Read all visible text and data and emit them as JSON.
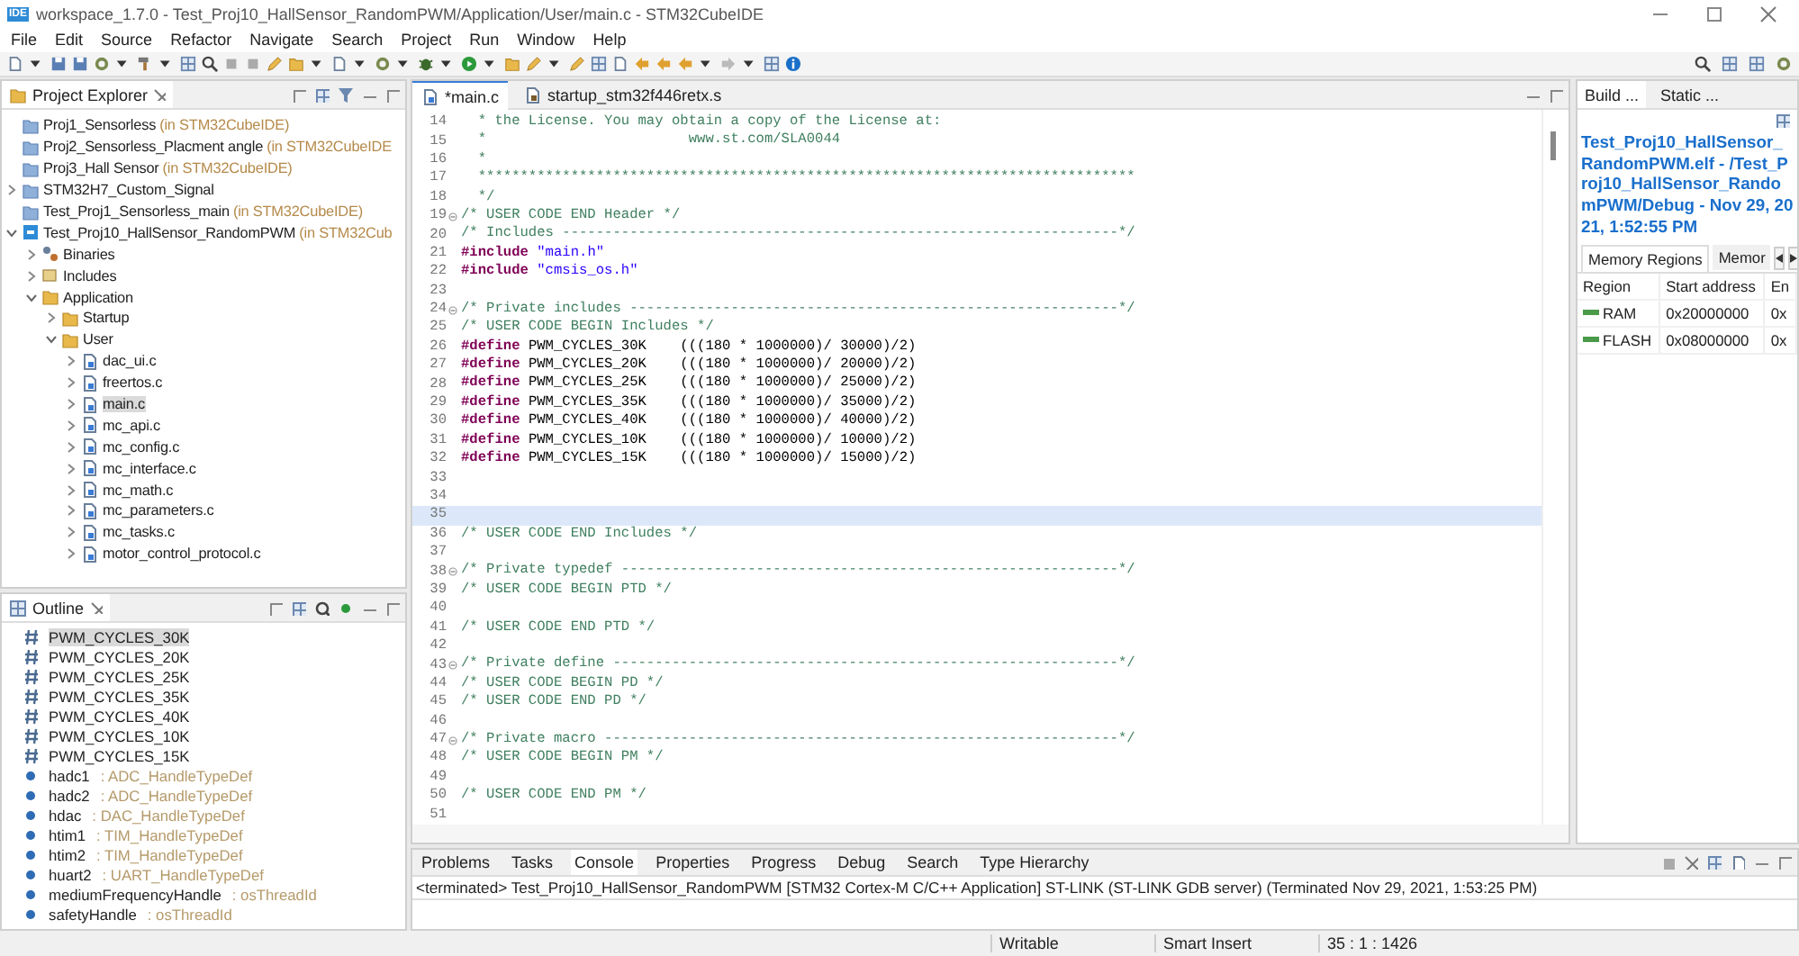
{
  "window": {
    "logo": "IDE",
    "title": "workspace_1.7.0 - Test_Proj10_HallSensor_RandomPWM/Application/User/main.c - STM32CubeIDE"
  },
  "menu": [
    "File",
    "Edit",
    "Source",
    "Refactor",
    "Navigate",
    "Search",
    "Project",
    "Run",
    "Window",
    "Help"
  ],
  "project_explorer": {
    "title": "Project Explorer",
    "items": [
      {
        "kind": "closed-project",
        "name": "Proj1_Sensorless",
        "location": "(in STM32CubeIDE)",
        "selected": false
      },
      {
        "kind": "closed-project",
        "name": "Proj2_Sensorless_Placment angle",
        "location": "(in STM32CubeIDE",
        "selected": false
      },
      {
        "kind": "closed-project",
        "name": "Proj3_Hall Sensor",
        "location": "(in STM32CubeIDE)",
        "selected": false
      },
      {
        "kind": "project",
        "name": "STM32H7_Custom_Signal",
        "expanded": false,
        "selected": false
      },
      {
        "kind": "closed-project",
        "name": "Test_Proj1_Sensorless_main",
        "location": "(in STM32CubeIDE)",
        "selected": false
      },
      {
        "kind": "ide-project",
        "name": "Test_Proj10_HallSensor_RandomPWM",
        "location": "(in STM32Cub",
        "expanded": true,
        "selected": false,
        "children": [
          {
            "kind": "binaries",
            "name": "Binaries",
            "expanded": false,
            "selected": false
          },
          {
            "kind": "includes",
            "name": "Includes",
            "expanded": false,
            "selected": false
          },
          {
            "kind": "folder",
            "name": "Application",
            "expanded": true,
            "selected": false,
            "children": [
              {
                "kind": "folder",
                "name": "Startup",
                "expanded": false,
                "selected": false
              },
              {
                "kind": "folder",
                "name": "User",
                "expanded": true,
                "selected": false,
                "children": [
                  {
                    "kind": "file",
                    "name": "dac_ui.c",
                    "expanded": false,
                    "selected": false
                  },
                  {
                    "kind": "file",
                    "name": "freertos.c",
                    "expanded": false,
                    "selected": false
                  },
                  {
                    "kind": "file",
                    "name": "main.c",
                    "expanded": false,
                    "selected": true
                  },
                  {
                    "kind": "file",
                    "name": "mc_api.c",
                    "expanded": false,
                    "selected": false
                  },
                  {
                    "kind": "file",
                    "name": "mc_config.c",
                    "expanded": false,
                    "selected": false
                  },
                  {
                    "kind": "file",
                    "name": "mc_interface.c",
                    "expanded": false,
                    "selected": false
                  },
                  {
                    "kind": "file",
                    "name": "mc_math.c",
                    "expanded": false,
                    "selected": false
                  },
                  {
                    "kind": "file",
                    "name": "mc_parameters.c",
                    "expanded": false,
                    "selected": false
                  },
                  {
                    "kind": "file",
                    "name": "mc_tasks.c",
                    "expanded": false,
                    "selected": false
                  },
                  {
                    "kind": "file",
                    "name": "motor_control_protocol.c",
                    "expanded": false,
                    "selected": false
                  }
                ]
              }
            ]
          }
        ]
      }
    ]
  },
  "outline": {
    "title": "Outline",
    "items": [
      {
        "kind": "macro",
        "name": "PWM_CYCLES_30K",
        "selected": true
      },
      {
        "kind": "macro",
        "name": "PWM_CYCLES_20K",
        "selected": false
      },
      {
        "kind": "macro",
        "name": "PWM_CYCLES_25K",
        "selected": false
      },
      {
        "kind": "macro",
        "name": "PWM_CYCLES_35K",
        "selected": false
      },
      {
        "kind": "macro",
        "name": "PWM_CYCLES_40K",
        "selected": false
      },
      {
        "kind": "macro",
        "name": "PWM_CYCLES_10K",
        "selected": false
      },
      {
        "kind": "macro",
        "name": "PWM_CYCLES_15K",
        "selected": false
      },
      {
        "kind": "variable",
        "name": "hadc1",
        "type": ": ADC_HandleTypeDef",
        "selected": false
      },
      {
        "kind": "variable",
        "name": "hadc2",
        "type": ": ADC_HandleTypeDef",
        "selected": false
      },
      {
        "kind": "variable",
        "name": "hdac",
        "type": ": DAC_HandleTypeDef",
        "selected": false
      },
      {
        "kind": "variable",
        "name": "htim1",
        "type": ": TIM_HandleTypeDef",
        "selected": false
      },
      {
        "kind": "variable",
        "name": "htim2",
        "type": ": TIM_HandleTypeDef",
        "selected": false
      },
      {
        "kind": "variable",
        "name": "huart2",
        "type": ": UART_HandleTypeDef",
        "selected": false
      },
      {
        "kind": "variable",
        "name": "mediumFrequencyHandle",
        "type": ": osThreadId",
        "selected": false
      },
      {
        "kind": "variable",
        "name": "safetyHandle",
        "type": ": osThreadId",
        "selected": false
      }
    ]
  },
  "editor": {
    "tabs": [
      {
        "label": "*main.c",
        "kind": "c-file",
        "selected": true
      },
      {
        "label": "startup_stm32f446retx.s",
        "kind": "asm-file",
        "selected": false
      }
    ],
    "lines": [
      {
        "number": "14",
        "fold": false,
        "current": false,
        "code": [
          {
            "kind": "comment",
            "text": "  * the License. You may obtain a copy of the License at:"
          }
        ]
      },
      {
        "number": "15",
        "fold": false,
        "current": false,
        "code": [
          {
            "kind": "comment",
            "text": "  *                        www.st.com/SLA0044"
          }
        ]
      },
      {
        "number": "16",
        "fold": false,
        "current": false,
        "code": [
          {
            "kind": "comment",
            "text": "  *"
          }
        ]
      },
      {
        "number": "17",
        "fold": false,
        "current": false,
        "code": [
          {
            "kind": "comment",
            "text": "  ******************************************************************************"
          }
        ]
      },
      {
        "number": "18",
        "fold": false,
        "current": false,
        "code": [
          {
            "kind": "comment",
            "text": "  */"
          }
        ]
      },
      {
        "number": "19",
        "fold": true,
        "current": false,
        "code": [
          {
            "kind": "comment",
            "text": "/* USER CODE END Header */"
          }
        ]
      },
      {
        "number": "20",
        "fold": false,
        "current": false,
        "code": [
          {
            "kind": "comment",
            "text": "/* Includes ------------------------------------------------------------------*/"
          }
        ]
      },
      {
        "number": "21",
        "fold": false,
        "current": false,
        "code": [
          {
            "kind": "keyword",
            "text": "#include "
          },
          {
            "kind": "string",
            "text": "\"main.h\""
          }
        ]
      },
      {
        "number": "22",
        "fold": false,
        "current": false,
        "code": [
          {
            "kind": "keyword",
            "text": "#include "
          },
          {
            "kind": "string",
            "text": "\"cmsis_os.h\""
          }
        ]
      },
      {
        "number": "23",
        "fold": false,
        "current": false
      },
      {
        "number": "24",
        "fold": true,
        "current": false,
        "code": [
          {
            "kind": "comment",
            "text": "/* Private includes ----------------------------------------------------------*/"
          }
        ]
      },
      {
        "number": "25",
        "fold": false,
        "current": false,
        "code": [
          {
            "kind": "comment",
            "text": "/* USER CODE BEGIN Includes */"
          }
        ]
      },
      {
        "number": "26",
        "fold": false,
        "current": false,
        "code": [
          {
            "kind": "keyword",
            "text": "#define"
          },
          {
            "kind": "plain",
            "text": " PWM_CYCLES_30K    (((180 * 1000000)/ 30000)/2)"
          }
        ]
      },
      {
        "number": "27",
        "fold": false,
        "current": false,
        "code": [
          {
            "kind": "keyword",
            "text": "#define"
          },
          {
            "kind": "plain",
            "text": " PWM_CYCLES_20K    (((180 * 1000000)/ 20000)/2)"
          }
        ]
      },
      {
        "number": "28",
        "fold": false,
        "current": false,
        "code": [
          {
            "kind": "keyword",
            "text": "#define"
          },
          {
            "kind": "plain",
            "text": " PWM_CYCLES_25K    (((180 * 1000000)/ 25000)/2)"
          }
        ]
      },
      {
        "number": "29",
        "fold": false,
        "current": false,
        "code": [
          {
            "kind": "keyword",
            "text": "#define"
          },
          {
            "kind": "plain",
            "text": " PWM_CYCLES_35K    (((180 * 1000000)/ 35000)/2)"
          }
        ]
      },
      {
        "number": "30",
        "fold": false,
        "current": false,
        "code": [
          {
            "kind": "keyword",
            "text": "#define"
          },
          {
            "kind": "plain",
            "text": " PWM_CYCLES_40K    (((180 * 1000000)/ 40000)/2)"
          }
        ]
      },
      {
        "number": "31",
        "fold": false,
        "current": false,
        "code": [
          {
            "kind": "keyword",
            "text": "#define"
          },
          {
            "kind": "plain",
            "text": " PWM_CYCLES_10K    (((180 * 1000000)/ 10000)/2)"
          }
        ]
      },
      {
        "number": "32",
        "fold": false,
        "current": false,
        "code": [
          {
            "kind": "keyword",
            "text": "#define"
          },
          {
            "kind": "plain",
            "text": " PWM_CYCLES_15K    (((180 * 1000000)/ 15000)/2)"
          }
        ]
      },
      {
        "number": "33",
        "fold": false,
        "current": false
      },
      {
        "number": "34",
        "fold": false,
        "current": false
      },
      {
        "number": "35",
        "fold": false,
        "current": true
      },
      {
        "number": "36",
        "fold": false,
        "current": false,
        "code": [
          {
            "kind": "comment",
            "text": "/* USER CODE END Includes */"
          }
        ]
      },
      {
        "number": "37",
        "fold": false,
        "current": false
      },
      {
        "number": "38",
        "fold": true,
        "current": false,
        "code": [
          {
            "kind": "comment",
            "text": "/* Private typedef -----------------------------------------------------------*/"
          }
        ]
      },
      {
        "number": "39",
        "fold": false,
        "current": false,
        "code": [
          {
            "kind": "comment",
            "text": "/* USER CODE BEGIN PTD */"
          }
        ]
      },
      {
        "number": "40",
        "fold": false,
        "current": false
      },
      {
        "number": "41",
        "fold": false,
        "current": false,
        "code": [
          {
            "kind": "comment",
            "text": "/* USER CODE END PTD */"
          }
        ]
      },
      {
        "number": "42",
        "fold": false,
        "current": false
      },
      {
        "number": "43",
        "fold": true,
        "current": false,
        "code": [
          {
            "kind": "comment",
            "text": "/* Private define ------------------------------------------------------------*/"
          }
        ]
      },
      {
        "number": "44",
        "fold": false,
        "current": false,
        "code": [
          {
            "kind": "comment",
            "text": "/* USER CODE BEGIN PD */"
          }
        ]
      },
      {
        "number": "45",
        "fold": false,
        "current": false,
        "code": [
          {
            "kind": "comment",
            "text": "/* USER CODE END PD */"
          }
        ]
      },
      {
        "number": "46",
        "fold": false,
        "current": false
      },
      {
        "number": "47",
        "fold": true,
        "current": false,
        "code": [
          {
            "kind": "comment",
            "text": "/* Private macro -------------------------------------------------------------*/"
          }
        ]
      },
      {
        "number": "48",
        "fold": false,
        "current": false,
        "code": [
          {
            "kind": "comment",
            "text": "/* USER CODE BEGIN PM */"
          }
        ]
      },
      {
        "number": "49",
        "fold": false,
        "current": false
      },
      {
        "number": "50",
        "fold": false,
        "current": false,
        "code": [
          {
            "kind": "comment",
            "text": "/* USER CODE END PM */"
          }
        ]
      },
      {
        "number": "51",
        "fold": false,
        "current": false
      }
    ]
  },
  "build_analyzer": {
    "tabs": [
      {
        "label": "Build ...",
        "selected": true
      },
      {
        "label": "Static ...",
        "selected": false
      }
    ],
    "file_link": "Test_Proj10_HallSensor_RandomPWM.elf - /Test_Proj10_HallSensor_RandomPWM/Debug - Nov 29, 2021, 1:52:55 PM",
    "subtabs": [
      {
        "label": "Memory Regions",
        "selected": true
      },
      {
        "label": "Memor",
        "selected": false
      }
    ],
    "table": {
      "columns": [
        "Region",
        "Start address",
        "En"
      ],
      "rows": [
        [
          "RAM",
          "0x20000000",
          "0x"
        ],
        [
          "FLASH",
          "0x08000000",
          "0x"
        ]
      ]
    }
  },
  "bottom_panel": {
    "tabs": [
      {
        "label": "Problems",
        "selected": false
      },
      {
        "label": "Tasks",
        "selected": false
      },
      {
        "label": "Console",
        "selected": true
      },
      {
        "label": "Properties",
        "selected": false
      },
      {
        "label": "Progress",
        "selected": false
      },
      {
        "label": "Debug",
        "selected": false
      },
      {
        "label": "Search",
        "selected": false
      },
      {
        "label": "Type Hierarchy",
        "selected": false
      }
    ],
    "console_header": "<terminated> Test_Proj10_HallSensor_RandomPWM [STM32 Cortex-M C/C++ Application] ST-LINK (ST-LINK GDB server) (Terminated Nov 29, 2021, 1:53:25 PM)"
  },
  "status_bar": [
    "Writable",
    "Smart Insert",
    "35 : 1 : 1426"
  ]
}
